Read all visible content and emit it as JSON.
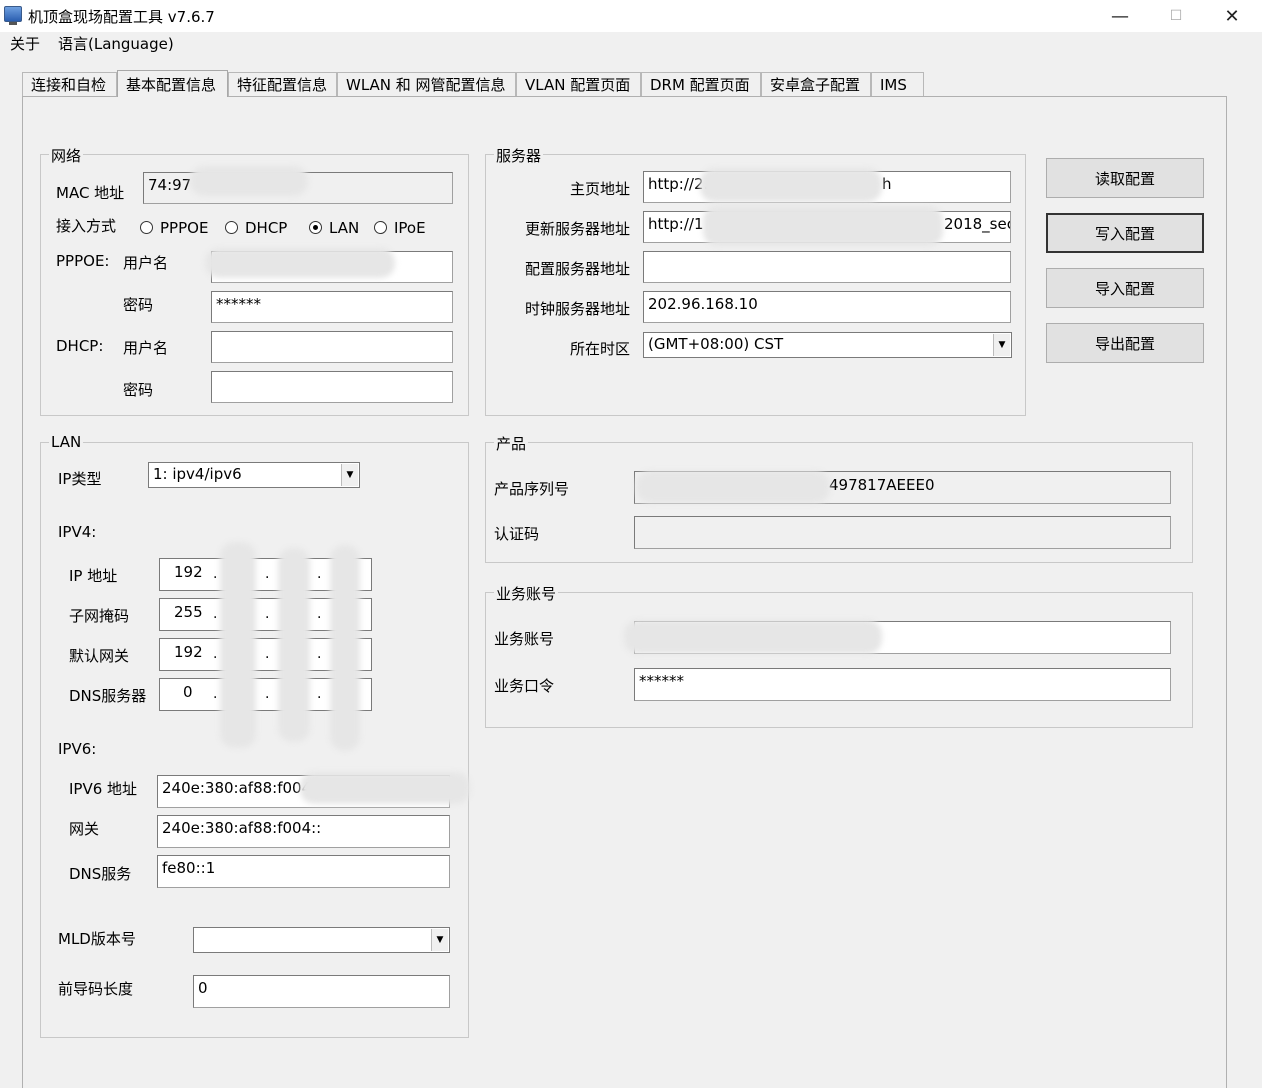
{
  "window": {
    "title": "机顶盒现场配置工具 v7.6.7",
    "minimize": "—",
    "maximize": "☐",
    "close": "✕"
  },
  "menu": [
    "关于",
    "语言(Language)"
  ],
  "tabs": [
    "连接和自检",
    "基本配置信息",
    "特征配置信息",
    "WLAN 和 网管配置信息",
    "VLAN 配置页面",
    "DRM 配置页面",
    "安卓盒子配置",
    "IMS"
  ],
  "network": {
    "title": "网络",
    "mac_label": "MAC 地址",
    "mac_value": "74:97",
    "access_label": "接入方式",
    "access_options": [
      "PPPOE",
      "DHCP",
      "LAN",
      "IPoE"
    ],
    "access_selected": "LAN",
    "pppoe_label": "PPPOE:",
    "dhcp_label": "DHCP:",
    "username_label": "用户名",
    "password_label": "密码",
    "pppoe_username": "",
    "pppoe_password": "******",
    "dhcp_username": "",
    "dhcp_password": ""
  },
  "server": {
    "title": "服务器",
    "home_label": "主页地址",
    "home_value": "http://2.",
    "home_value_tail": "h",
    "update_label": "更新服务器地址",
    "update_value": "http://1",
    "update_value_tail": "2018_sec",
    "config_label": "配置服务器地址",
    "config_value": "",
    "clock_label": "时钟服务器地址",
    "clock_value": "202.96.168.10",
    "tz_label": "所在时区",
    "tz_value": "(GMT+08:00) CST"
  },
  "buttons": {
    "read": "读取配置",
    "write": "写入配置",
    "import": "导入配置",
    "export": "导出配置"
  },
  "lan": {
    "title": "LAN",
    "ip_type_label": "IP类型",
    "ip_type_value": "1: ipv4/ipv6",
    "ipv4_label": "IPV4:",
    "ip_label": "IP 地址",
    "ip_first": "192",
    "mask_label": "子网掩码",
    "mask_first": "255",
    "gw_label": "默认网关",
    "gw_first": "192",
    "dns_label": "DNS服务器",
    "dns_first": "0",
    "ipv6_label": "IPV6:",
    "ipv6_addr_label": "IPV6 地址",
    "ipv6_addr_value": "240e:380:af88:f004:",
    "ipv6_gw_label": "网关",
    "ipv6_gw_value": "240e:380:af88:f004::",
    "ipv6_dns_label": "DNS服务",
    "ipv6_dns_value": "fe80::1",
    "mld_label": "MLD版本号",
    "mld_value": "",
    "prefix_label": "前导码长度",
    "prefix_value": "0"
  },
  "product": {
    "title": "产品",
    "serial_label": "产品序列号",
    "serial_value": "497817AEEE0",
    "auth_label": "认证码",
    "auth_value": ""
  },
  "business": {
    "title": "业务账号",
    "account_label": "业务账号",
    "account_value": "",
    "password_label": "业务口令",
    "password_value": "******"
  }
}
